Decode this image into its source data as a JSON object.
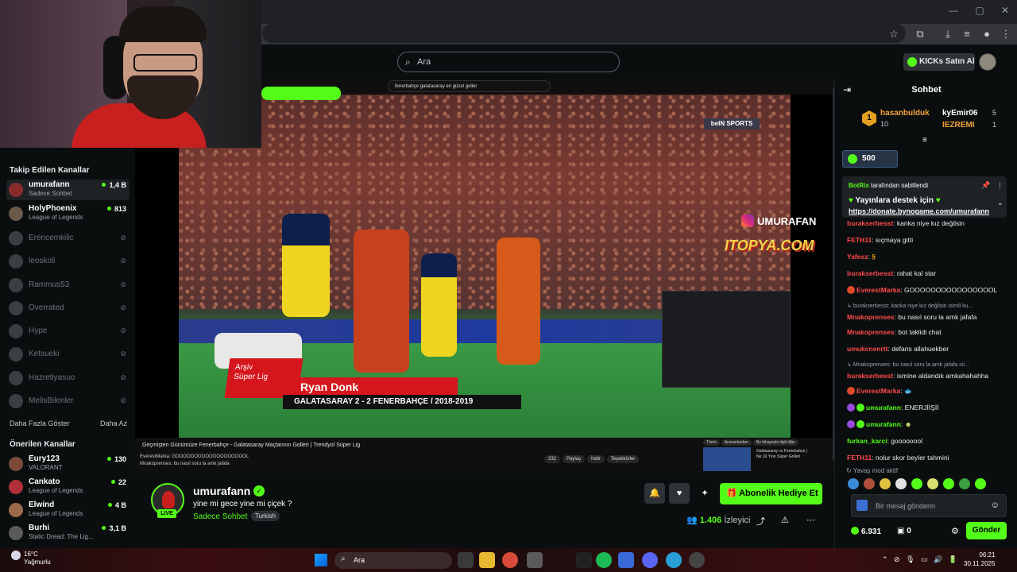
{
  "search": {
    "placeholder": "Ara"
  },
  "header": {
    "kicks_button": "KICKs Satın Al"
  },
  "sidebar": {
    "followed_title": "Takip Edilen Kanallar",
    "followed": [
      {
        "name": "umurafann",
        "category": "Sadece Sohbet",
        "viewers": "1,4 B",
        "live": true
      },
      {
        "name": "HolyPhoenix",
        "category": "League of Legends",
        "viewers": "813",
        "live": true
      },
      {
        "name": "Erencemkilic",
        "live": false
      },
      {
        "name": "leoskoli",
        "live": false
      },
      {
        "name": "Rammus53",
        "live": false
      },
      {
        "name": "Overrated",
        "live": false
      },
      {
        "name": "Hype",
        "live": false
      },
      {
        "name": "Ketsueki",
        "live": false
      },
      {
        "name": "Hazretiyasuo",
        "live": false
      },
      {
        "name": "MelisBilenler",
        "live": false
      }
    ],
    "show_more": "Daha Fazla Göster",
    "show_less": "Daha Az",
    "recommended_title": "Önerilen Kanallar",
    "recommended": [
      {
        "name": "Eury123",
        "category": "VALORANT",
        "viewers": "130"
      },
      {
        "name": "Cankato",
        "category": "League of Legends",
        "viewers": "22"
      },
      {
        "name": "Elwind",
        "category": "League of Legends",
        "viewers": "4 B"
      },
      {
        "name": "Burhi",
        "category": "Static Dread: The Lig...",
        "viewers": "3,1 B"
      }
    ]
  },
  "video": {
    "yt_search": "fenerbahçe galatasaray en güzel goller",
    "lower_third_badge_1": "Arşiv",
    "lower_third_badge_2": "Süper Lig",
    "lower_third_name": "Ryan Donk",
    "lower_third_score": "GALATASARAY 2 - 2 FENERBAHÇE  / 2018-2019",
    "broadcaster": "beIN SPORTS",
    "ig_handle": "UMURAFAN",
    "sponsor": "ITOPYA.COM",
    "yt_title": "Geçmişten Günümüze Fenerbahçe - Galatasaray Maçlarının Golleri | Trendyol Süper Lig",
    "yt_mini_chat": [
      "EverestMarka: GOOOOOOOOOOOOOOOOOOOL",
      "Mnakoprenses: bu nasıl soru la amk jafafa"
    ],
    "yt_actions": [
      "232",
      "Paylaş",
      "İndir",
      "Teşekkürler"
    ],
    "yt_side_tabs": [
      "Tümü",
      "Arananlardan",
      "Bu hikayeyle ilgili diğe"
    ],
    "yt_side_title": "Galatasaray vs Fenerbahçe | Ne 10 Yılın Süper Golleri"
  },
  "stream": {
    "channel": "umurafann",
    "title": "yine mi gece yine mi çiçek ?",
    "category": "Sadece Sohbet",
    "tag": "Turkish",
    "live_label": "LIVE",
    "gift_button": "Abonelik Hediye Et",
    "viewers": "1.406",
    "viewers_label": "İzleyici"
  },
  "chat": {
    "title": "Sohbet",
    "leaderboard": [
      {
        "rank": "1",
        "name": "hasanbulduk",
        "value": "10"
      },
      {
        "name": "kyEmir06",
        "value": "5"
      },
      {
        "name": "IEZREMI",
        "value": "1"
      }
    ],
    "kicks_goal": "500",
    "pinned_by": "BotRix",
    "pinned_by_suffix": "tarafından sabitlendi",
    "pinned_text": "Yayınlara destek için",
    "pinned_link": "https://donate.bynogame.com/umurafann",
    "messages": [
      {
        "user": "burakserbesst",
        "text": "kanka niye kız değilsin",
        "color": "#ff4a4a"
      },
      {
        "user": "FETH11",
        "text": "sıçmaya gitti",
        "color": "#ff4a4a"
      },
      {
        "user": "Yafesz",
        "text": "",
        "color": "#ff4a4a",
        "emote": true
      },
      {
        "user": "burakserbesst",
        "text": "rahat kal star",
        "color": "#ff4a4a"
      },
      {
        "user": "EverestMarka",
        "text": "GOOOOOOOOOOOOOOOOL",
        "color": "#ff4a4a",
        "badge": true
      },
      {
        "reply": "burakserbesst: kanka niye kız değilsin isimli ku..."
      },
      {
        "user": "Mnakoprenses",
        "text": "bu nasıl soru la amk jafafa",
        "color": "#ff4a4a"
      },
      {
        "user": "Mnakoprenses",
        "text": "bot taklidi chat",
        "color": "#ff4a4a"
      },
      {
        "user": "umukcnenrtt",
        "text": "defans allahuekber",
        "color": "#ff4a4a"
      },
      {
        "reply": "Mnakoprenses: bu nasıl soru la amk jafafa isl..."
      },
      {
        "user": "burakserbesst",
        "text": "ismine aldandık amkahahahha",
        "color": "#ff4a4a"
      },
      {
        "user": "EverestMarka",
        "text": "",
        "color": "#ff4a4a",
        "badge": true,
        "emote": true
      },
      {
        "user": "umurafann",
        "text": "ENERJİİŞİİ",
        "color": "#53fc18",
        "badge": true
      },
      {
        "user": "umurafann",
        "text": "",
        "color": "#53fc18",
        "badge": true,
        "emote": true
      },
      {
        "user": "furkan_karci",
        "text": "goooooool",
        "color": "#53fc18"
      },
      {
        "user": "FETH11",
        "text": "nolur skor beyler tahmini",
        "color": "#ff4a4a"
      }
    ],
    "slow_mode": "Yavaş mod aktif",
    "input_placeholder": "Bir mesaj gönderin",
    "kick_balance": "6.931",
    "box_balance": "0",
    "send_button": "Gönder"
  },
  "taskbar": {
    "temperature": "16°C",
    "weather": "Yağmurlu",
    "search": "Ara",
    "time": "06:21",
    "date": "30.11.2025"
  },
  "colors": {
    "accent": "#53fc18",
    "bg": "#0b0e0f",
    "panel": "#1e2225",
    "danger": "#ff4a4a",
    "tier": "#f3a13a"
  }
}
